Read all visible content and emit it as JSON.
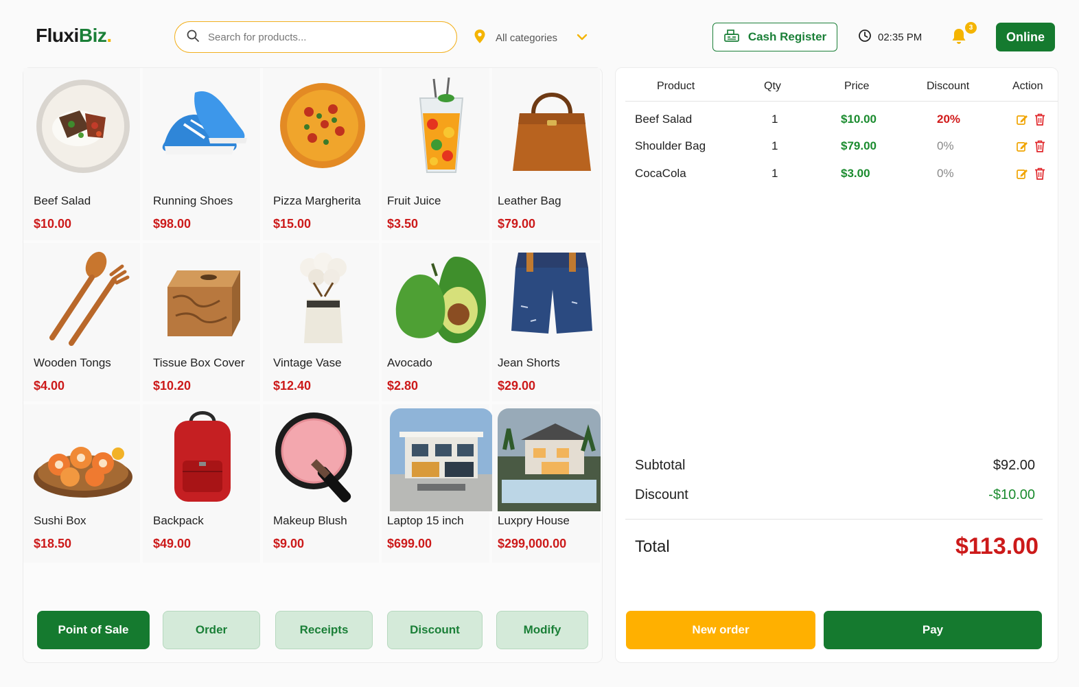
{
  "header": {
    "logo_main": "Fluxi",
    "logo_accent": "Biz",
    "logo_dot": ".",
    "search_placeholder": "Search for products...",
    "category_label": "All categories",
    "cash_register_label": "Cash Register",
    "time": "02:35 PM",
    "notification_count": "3",
    "online_label": "Online"
  },
  "products": [
    {
      "name": "Beef Salad",
      "price": "$10.00",
      "icon": "beef-salad-image"
    },
    {
      "name": "Running Shoes",
      "price": "$98.00",
      "icon": "running-shoes-image"
    },
    {
      "name": "Pizza Margherita",
      "price": "$15.00",
      "icon": "pizza-image"
    },
    {
      "name": "Fruit Juice",
      "price": "$3.50",
      "icon": "fruit-juice-image"
    },
    {
      "name": "Leather Bag",
      "price": "$79.00",
      "icon": "leather-bag-image"
    },
    {
      "name": "Wooden Tongs",
      "price": "$4.00",
      "icon": "wooden-tongs-image"
    },
    {
      "name": "Tissue Box Cover",
      "price": "$10.20",
      "icon": "tissue-box-image"
    },
    {
      "name": "Vintage Vase",
      "price": "$12.40",
      "icon": "vintage-vase-image"
    },
    {
      "name": "Avocado",
      "price": "$2.80",
      "icon": "avocado-image"
    },
    {
      "name": "Jean Shorts",
      "price": "$29.00",
      "icon": "jean-shorts-image"
    },
    {
      "name": "Sushi Box",
      "price": "$18.50",
      "icon": "sushi-box-image"
    },
    {
      "name": "Backpack",
      "price": "$49.00",
      "icon": "backpack-image"
    },
    {
      "name": "Makeup Blush",
      "price": "$9.00",
      "icon": "makeup-blush-image"
    },
    {
      "name": "Laptop 15 inch",
      "price": "$699.00",
      "icon": "house-photo-image"
    },
    {
      "name": "Luxpry House",
      "price": "$299,000.00",
      "icon": "luxury-house-image"
    }
  ],
  "nav": [
    {
      "label": "Point of Sale",
      "active": true
    },
    {
      "label": "Order",
      "active": false
    },
    {
      "label": "Receipts",
      "active": false
    },
    {
      "label": "Discount",
      "active": false
    },
    {
      "label": "Modify",
      "active": false
    }
  ],
  "cart": {
    "headers": [
      "Product",
      "Qty",
      "Price",
      "Discount",
      "Action"
    ],
    "rows": [
      {
        "product": "Beef Salad",
        "qty": "1",
        "price": "$10.00",
        "discount": "20%"
      },
      {
        "product": "Shoulder Bag",
        "qty": "1",
        "price": "$79.00",
        "discount": "0%"
      },
      {
        "product": "CocaCola",
        "qty": "1",
        "price": "$3.00",
        "discount": "0%"
      }
    ],
    "subtotal_label": "Subtotal",
    "subtotal_value": "$92.00",
    "discount_label": "Discount",
    "discount_value": "-$10.00",
    "total_label": "Total",
    "total_value": "$113.00",
    "new_order_label": "New order",
    "pay_label": "Pay"
  },
  "colors": {
    "brand_green": "#157a2f",
    "accent_yellow": "#ffb000",
    "price_red": "#cc1a1a",
    "cart_price_green": "#1a8b2e"
  }
}
